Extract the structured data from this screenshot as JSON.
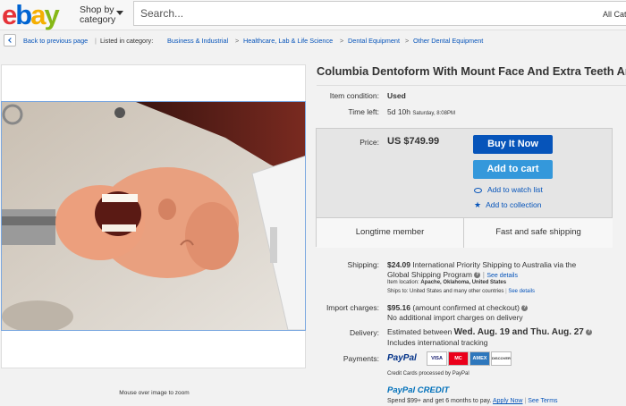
{
  "header": {
    "logo_letters": [
      "e",
      "b",
      "a",
      "y"
    ],
    "logo_colors": [
      "#e53238",
      "#0064d2",
      "#f5af02",
      "#86b817"
    ],
    "shop_by": "Shop by",
    "category": "category",
    "search_placeholder": "Search...",
    "all_categories": "All Cate"
  },
  "breadcrumb": {
    "back": "Back to previous page",
    "listed": "Listed in category:",
    "items": [
      "Business & Industrial",
      "Healthcare, Lab & Life Science",
      "Dental Equipment",
      "Other Dental Equipment"
    ],
    "separator": ">"
  },
  "image": {
    "zoom_hint": "Mouse over image to zoom"
  },
  "listing": {
    "title": "Columbia Dentoform With Mount Face And Extra Teeth And",
    "condition_label": "Item condition:",
    "condition": "Used",
    "time_label": "Time left:",
    "time_left": "5d 10h",
    "time_end": "Saturday, 8:08PM",
    "price_label": "Price:",
    "price": "US $749.99",
    "buy_now": "Buy It Now",
    "add_to_cart": "Add to cart",
    "watch": "Add to watch list",
    "collection": "Add to collection",
    "badge_1": "Longtime member",
    "badge_2": "Fast and safe shipping"
  },
  "shipping": {
    "label": "Shipping:",
    "cost": "$24.09",
    "desc": "International Priority Shipping to Australia  via the",
    "desc2": "Global Shipping Program",
    "see_details": "See details",
    "location_label": "Item location:",
    "location": "Apache, Oklahoma, United States",
    "ships_to_label": "Ships to:",
    "ships_to": "United States and many other countries",
    "see_details_2": "See details"
  },
  "import": {
    "label": "Import charges:",
    "cost": "$95.16",
    "note": "(amount confirmed at checkout)",
    "line2": "No additional import charges on delivery"
  },
  "delivery": {
    "label": "Delivery:",
    "prefix": "Estimated between",
    "range": "Wed. Aug. 19 and Thu. Aug. 27",
    "line2": "Includes international tracking"
  },
  "payments": {
    "label": "Payments:",
    "paypal": "PayPal",
    "cards": [
      "VISA",
      "MC",
      "AMEX",
      "DISCOVER"
    ],
    "processed": "Credit Cards processed by PayPal",
    "credit_brand": "PayPal CREDIT",
    "credit_text": "Spend $99+ and get 6 months to pay.",
    "apply": "Apply Now",
    "terms": "See Terms"
  }
}
